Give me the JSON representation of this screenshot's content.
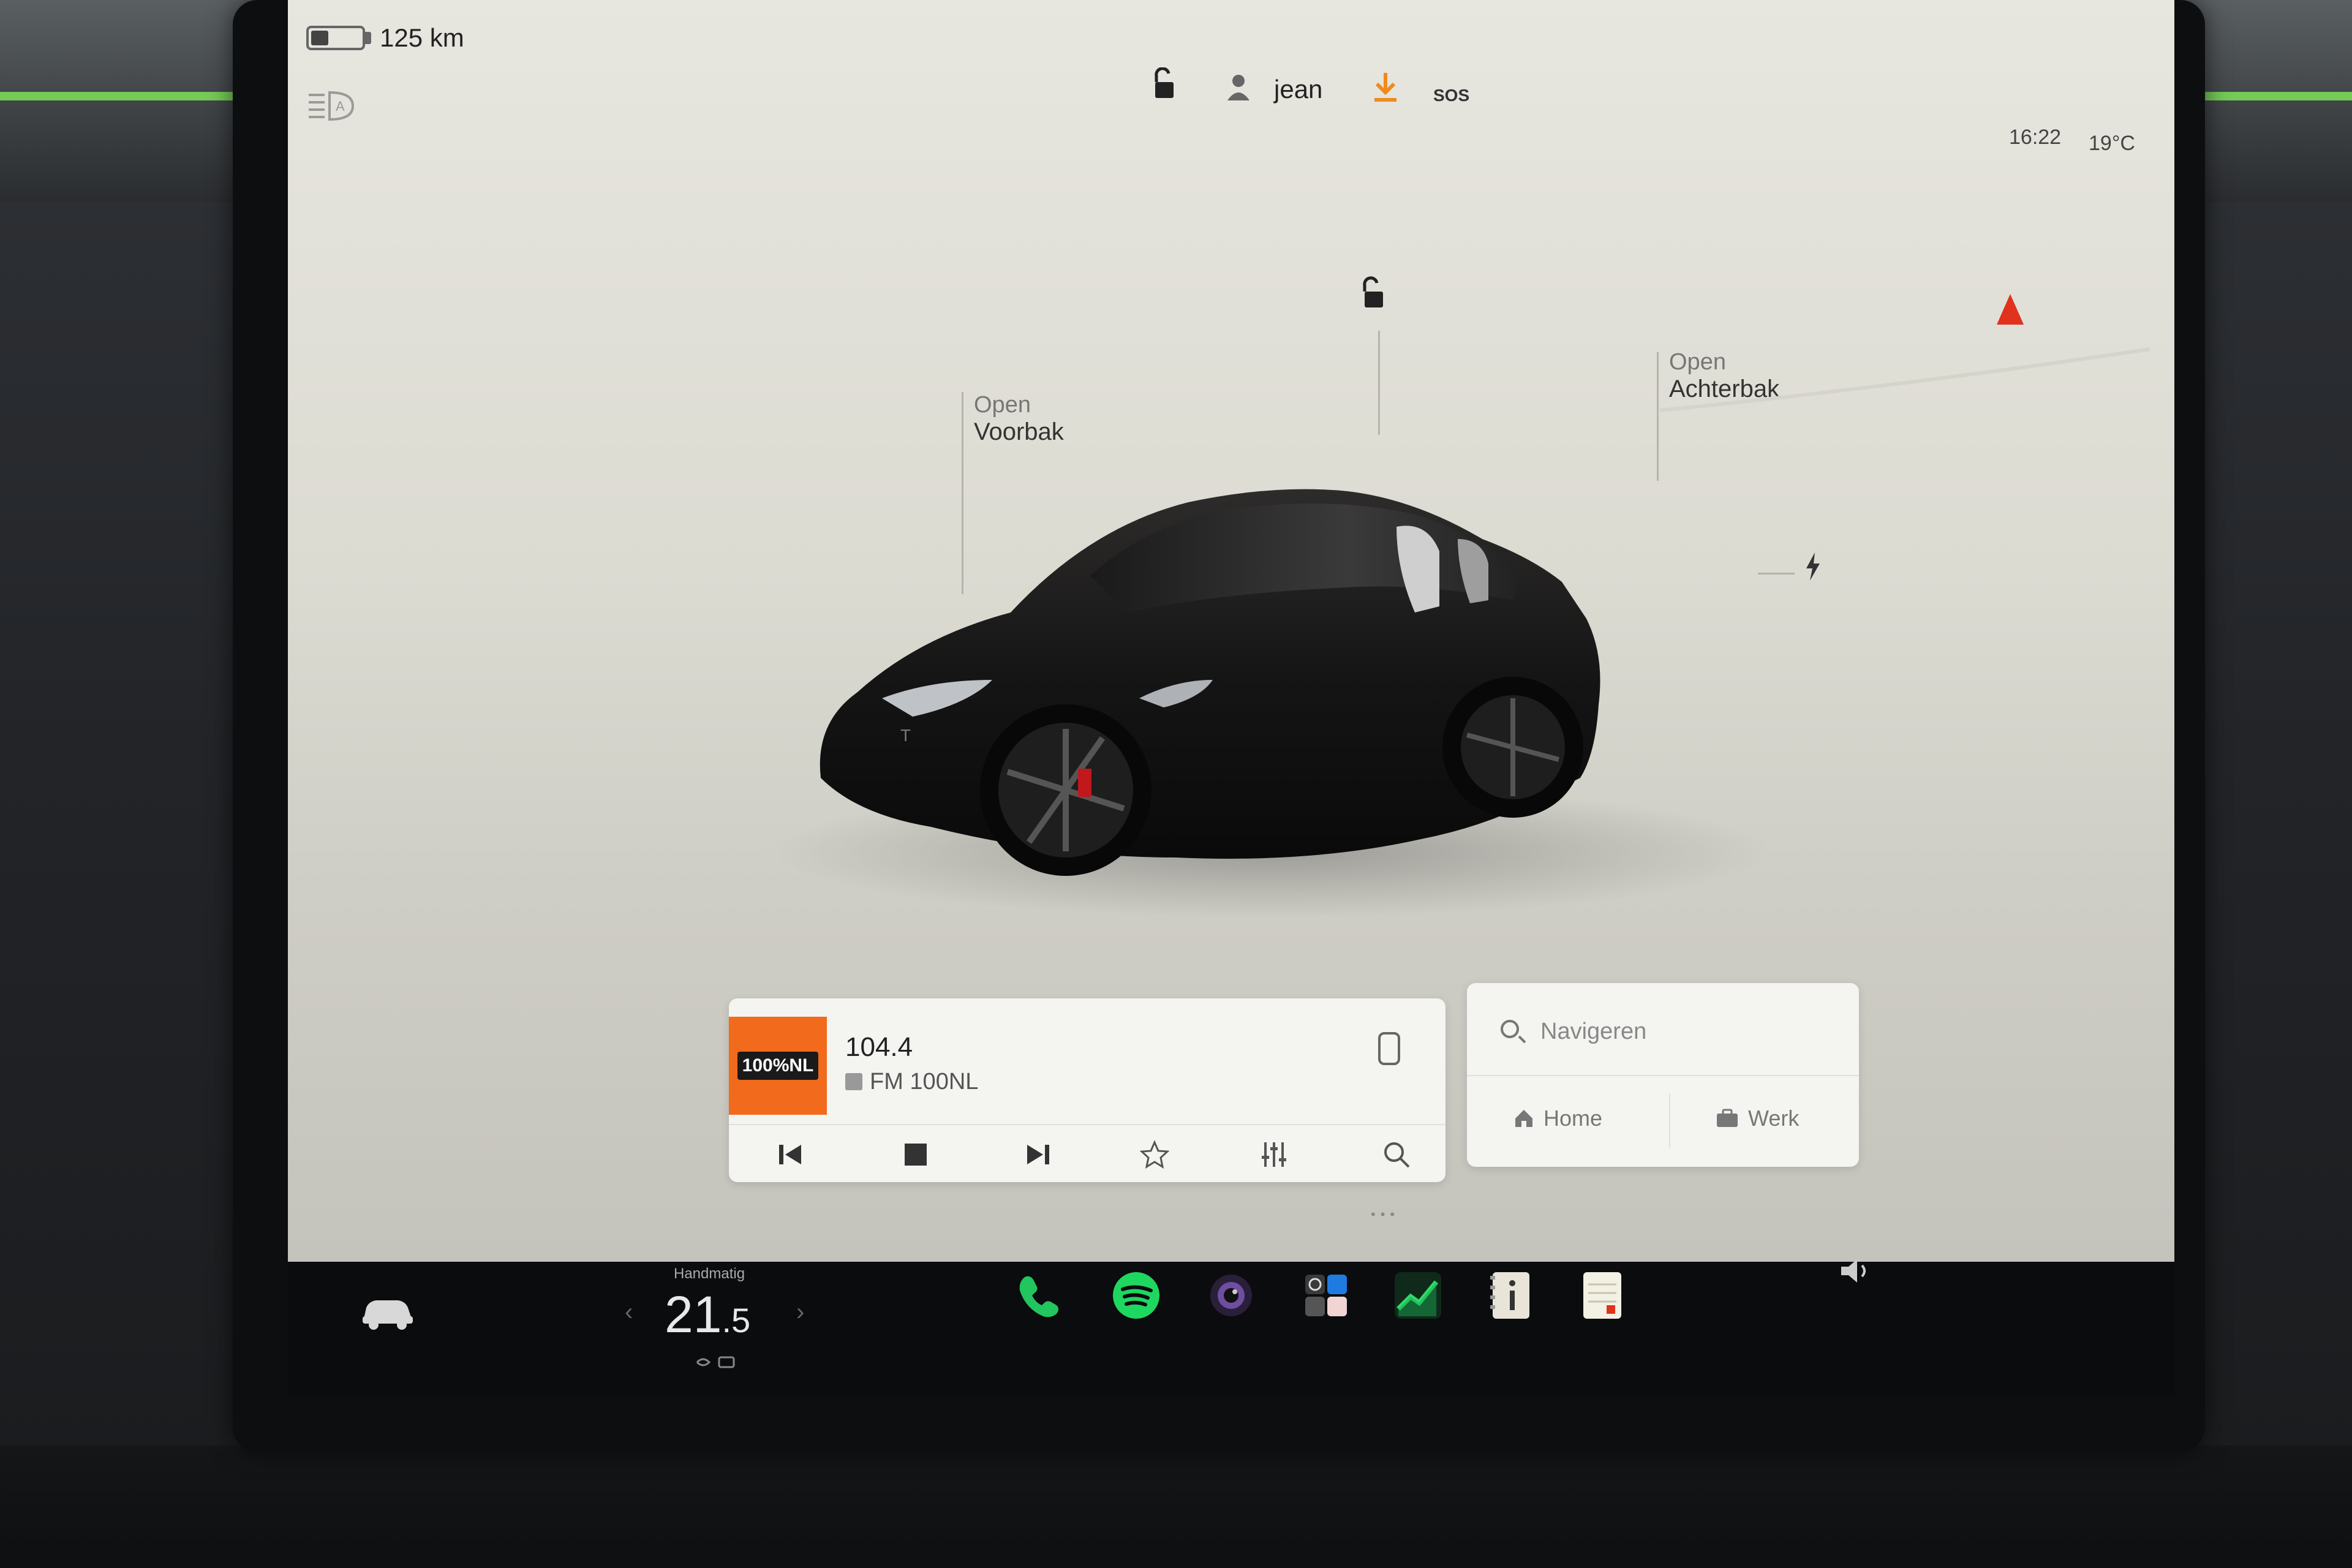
{
  "status_bar": {
    "range": "125 km",
    "battery_level_fraction": 0.35,
    "user_name": "jean",
    "sos_label": "SOS",
    "time": "16:22",
    "temperature": "19°C"
  },
  "car_view": {
    "frunk": {
      "action": "Open",
      "label": "Voorbak"
    },
    "trunk": {
      "action": "Open",
      "label": "Achterbak"
    }
  },
  "media": {
    "station_logo_text": "100%NL",
    "frequency": "104.4",
    "station": "FM 100NL",
    "controls": [
      "previous",
      "stop",
      "next",
      "favorite",
      "equalizer",
      "search"
    ]
  },
  "navigation": {
    "search_placeholder": "Navigeren",
    "shortcuts": [
      {
        "label": "Home",
        "icon": "home-icon"
      },
      {
        "label": "Werk",
        "icon": "briefcase-icon"
      }
    ]
  },
  "dock": {
    "hvac_mode": "Handmatig",
    "hvac_temp_whole": "21",
    "hvac_temp_decimal": ".5",
    "apps": [
      "phone-app",
      "spotify-app",
      "camera-app",
      "toybox-app",
      "energy-app",
      "manual-app",
      "notes-app"
    ]
  },
  "colors": {
    "accent_orange": "#f26a1c",
    "phone_green": "#22c55e",
    "spotify_green": "#1ed760",
    "nav_red": "#e0321c",
    "screen_bg": "#e3e2da"
  }
}
